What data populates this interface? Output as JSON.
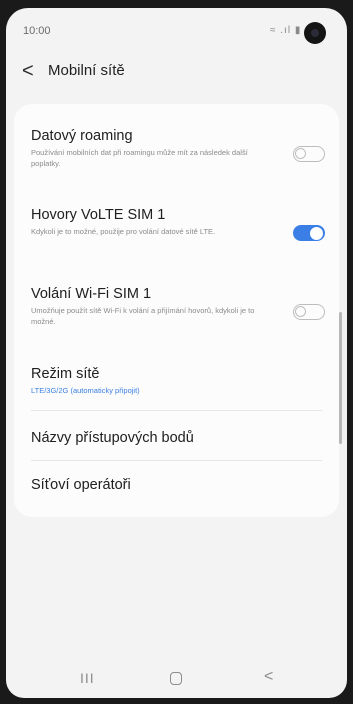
{
  "status_bar": {
    "time": "10:00",
    "icons": "≈ .ıl ▮"
  },
  "header": {
    "back_glyph": "<",
    "title": "Mobilní sítě"
  },
  "settings": [
    {
      "title": "Datový roaming",
      "subtitle": "Používání mobilních dat při roamingu může mít za následek další poplatky.",
      "toggle": false
    },
    {
      "title": "Hovory VoLTE SIM 1",
      "subtitle": "Kdykoli je to možné, použije pro volání datové sítě LTE.",
      "toggle": true
    },
    {
      "title": "Volání Wi-Fi SIM 1",
      "subtitle": "Umožňuje použít sítě Wi-Fi k volání a přijímání hovorů, kdykoli je to možné.",
      "toggle": false
    },
    {
      "title": "Režim sítě",
      "subtitle": "LTE/3G/2G (automaticky připojit)"
    },
    {
      "title": "Názvy přístupových bodů"
    },
    {
      "title": "Síťoví operátoři"
    }
  ],
  "nav": {
    "recents": "III",
    "back": "<"
  },
  "colors": {
    "accent": "#3b7fe6",
    "background": "#f3f3f3",
    "card": "#fcfcfc"
  }
}
